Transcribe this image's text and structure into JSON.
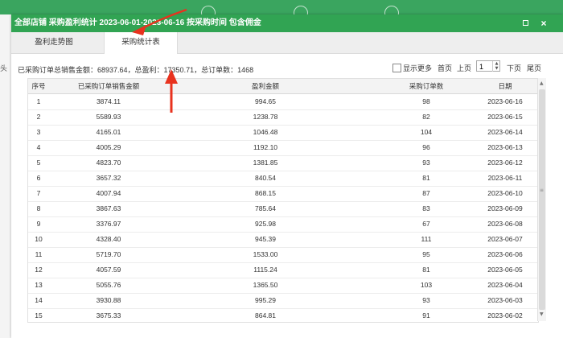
{
  "background": {
    "left_char": "头"
  },
  "dialog": {
    "title": "全部店铺  采购盈利统计  2023-06-01-2023-06-16 按采购时间 包含佣金",
    "buttons": {
      "maximize": "",
      "close": "×"
    }
  },
  "tabs": [
    {
      "label": "盈利走势图"
    },
    {
      "label": "采购统计表"
    }
  ],
  "summary": "已采购订单总销售金额：68937.64，总盈利：17350.71，总订单数：1468",
  "toolbar": {
    "show_more": "显示更多",
    "first": "首页",
    "prev": "上页",
    "page": "1",
    "next": "下页",
    "last": "尾页"
  },
  "table": {
    "headers": [
      "序号",
      "已采购订单销售金额",
      "盈利金额",
      "采购订单数",
      "日期"
    ],
    "rows": [
      [
        "1",
        "3874.11",
        "994.65",
        "98",
        "2023-06-16"
      ],
      [
        "2",
        "5589.93",
        "1238.78",
        "82",
        "2023-06-15"
      ],
      [
        "3",
        "4165.01",
        "1046.48",
        "104",
        "2023-06-14"
      ],
      [
        "4",
        "4005.29",
        "1192.10",
        "96",
        "2023-06-13"
      ],
      [
        "5",
        "4823.70",
        "1381.85",
        "93",
        "2023-06-12"
      ],
      [
        "6",
        "3657.32",
        "840.54",
        "81",
        "2023-06-11"
      ],
      [
        "7",
        "4007.94",
        "868.15",
        "87",
        "2023-06-10"
      ],
      [
        "8",
        "3867.63",
        "785.64",
        "83",
        "2023-06-09"
      ],
      [
        "9",
        "3376.97",
        "925.98",
        "67",
        "2023-06-08"
      ],
      [
        "10",
        "4328.40",
        "945.39",
        "111",
        "2023-06-07"
      ],
      [
        "11",
        "5719.70",
        "1533.00",
        "95",
        "2023-06-06"
      ],
      [
        "12",
        "4057.59",
        "1115.24",
        "81",
        "2023-06-05"
      ],
      [
        "13",
        "5055.76",
        "1365.50",
        "103",
        "2023-06-04"
      ],
      [
        "14",
        "3930.88",
        "995.29",
        "93",
        "2023-06-03"
      ],
      [
        "15",
        "3675.33",
        "864.81",
        "91",
        "2023-06-02"
      ]
    ]
  },
  "colors": {
    "accent": "#31a453",
    "annotation_arrow": "#e8321e"
  }
}
